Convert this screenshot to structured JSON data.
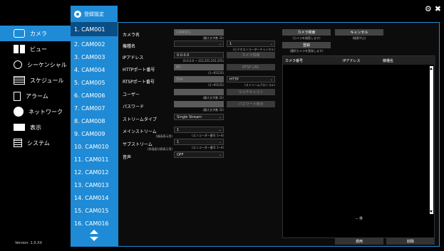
{
  "header": {
    "active_tab": "登録設定",
    "settings_icon": "gear-icon",
    "close_icon": "close-icon"
  },
  "nav": {
    "items": [
      {
        "label": "カメラ",
        "icon": "camera-icon"
      },
      {
        "label": "ビュー",
        "icon": "view-icon"
      },
      {
        "label": "シーケンシャル",
        "icon": "sequence-icon"
      },
      {
        "label": "スケジュール",
        "icon": "calendar-icon"
      },
      {
        "label": "アラーム",
        "icon": "alarm-icon"
      },
      {
        "label": "ネットワーク",
        "icon": "globe-icon"
      },
      {
        "label": "表示",
        "icon": "monitor-icon"
      },
      {
        "label": "システム",
        "icon": "system-icon"
      }
    ],
    "version": "Version: 1.0.XX"
  },
  "channels": [
    "1. CAM001",
    "2. CAM002",
    "3. CAM003",
    "4. CAM004",
    "5. CAM005",
    "6. CAM006",
    "7. CAM007",
    "8. CAM008",
    "9. CAM009",
    "10. CAM010",
    "11. CAM011",
    "12. CAM012",
    "13. CAM013",
    "14. CAM014",
    "15. CAM015",
    "16. CAM016"
  ],
  "form": {
    "camera_name_label": "カメラ名",
    "camera_name_value": "CAM001",
    "camera_name_hint": "(最大文字数 32)",
    "model_label": "機種名",
    "encoder_value": "1",
    "encoder_hint": "(ビデオエンコーダーチャンネル)",
    "camera_info_btn": "カメラ情報",
    "ip_label": "IPアドレス",
    "ip_value": "0.0.0.0",
    "ip_hint": "(0.0.0.0 ~ 223.255.255.255)",
    "http_label": "HTTPポート番号",
    "http_value": "80",
    "http_hint": "(1~65535)",
    "rtsp_url_btn": "RTSP URL",
    "rtsp_label": "RTSPポート番号",
    "rtsp_value": "554",
    "rtsp_hint": "(1~65535)",
    "protocol_value": "HTTP",
    "protocol_hint": "(ストリームプロトコル)",
    "multicast_btn": "マルチキャスト",
    "user_label": "ユーザー",
    "user_hint": "(最大文字数 32)",
    "password_label": "パスワード",
    "password_hint": "(最大文字数 32)",
    "password_show_btn": "パスワード表示",
    "stream_type_label": "ストリームタイプ",
    "stream_type_value": "Single Stream",
    "main_stream_label": "メインストリーム",
    "main_stream_sub": "(録画表示用)",
    "main_stream_value": "1",
    "main_stream_hint": "(エンコーダー番号 1~4)",
    "sub_stream_label": "サブストリーム",
    "sub_stream_sub": "(多画面分割表示用)",
    "sub_stream_value": "1",
    "sub_stream_hint": "(エンコーダー番号 1~4)",
    "audio_label": "音声",
    "audio_value": "OFF"
  },
  "search": {
    "search_btn": "カメラ検索",
    "search_hint": "(カメラを検索します)",
    "cancel_btn": "キャンセル",
    "cancel_hint": "(検索中止)",
    "register_btn": "登録",
    "register_hint": "(選択カメラを登録します)",
    "col_camera_no": "カメラ番号",
    "col_ip": "IPアドレス",
    "col_model": "機種名",
    "count": "-- 件"
  },
  "footer": {
    "apply_btn": "適用",
    "delete_btn": "削除"
  },
  "colors": {
    "accent": "#1f8bd6",
    "active_channel": "#0a4e86"
  }
}
